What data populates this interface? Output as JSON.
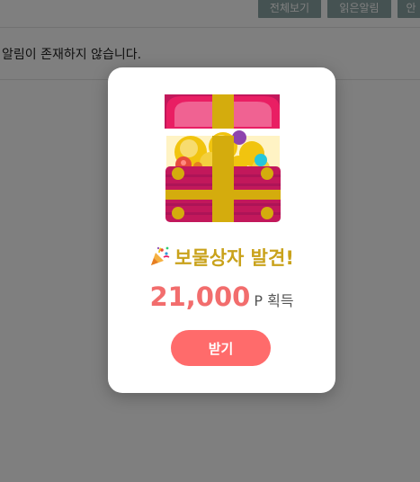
{
  "topbar": {
    "buttons": [
      {
        "label": "전체보기"
      },
      {
        "label": "읽은알림"
      },
      {
        "label": "안"
      }
    ]
  },
  "notifications": {
    "empty_message": "알림이 존재하지 않습니다."
  },
  "modal": {
    "icon": "treasure-chest-icon",
    "title_icon": "party-popper-icon",
    "title": "보물상자 발견!",
    "reward_amount": "21,000",
    "reward_unit": "P 획득",
    "claim_label": "받기"
  },
  "colors": {
    "accent": "#ff6b6b",
    "title": "#c9a21b",
    "amount": "#f26d6d",
    "topbar_button": "#8aa5a4"
  }
}
